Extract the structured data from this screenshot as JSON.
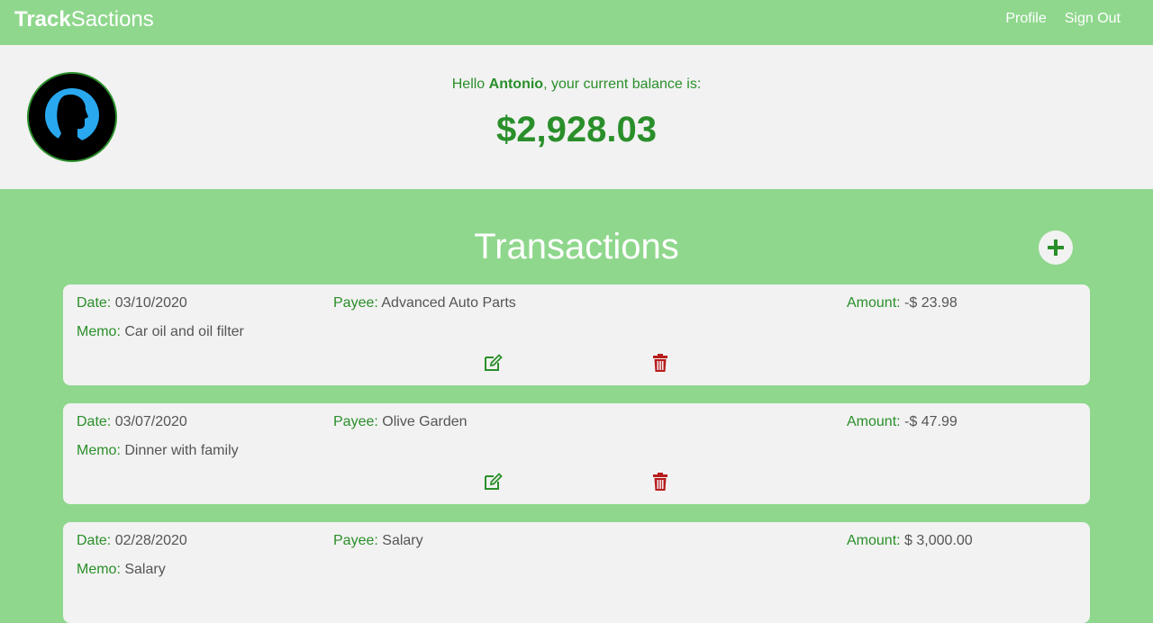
{
  "navbar": {
    "brand_bold": "Track",
    "brand_rest": "Sactions",
    "links": [
      {
        "label": "Profile"
      },
      {
        "label": "Sign Out"
      }
    ]
  },
  "header": {
    "greeting_prefix": "Hello ",
    "user_name": "Antonio",
    "greeting_suffix": ", your current balance is:",
    "balance": "$2,928.03"
  },
  "transactions": {
    "title": "Transactions",
    "labels": {
      "date": "Date:",
      "payee": "Payee:",
      "amount": "Amount:",
      "memo": "Memo:"
    },
    "items": [
      {
        "date": "03/10/2020",
        "payee": "Advanced Auto Parts",
        "amount": "-$ 23.98",
        "memo": "Car oil and oil filter"
      },
      {
        "date": "03/07/2020",
        "payee": "Olive Garden",
        "amount": "-$ 47.99",
        "memo": "Dinner with family"
      },
      {
        "date": "02/28/2020",
        "payee": "Salary",
        "amount": "$ 3,000.00",
        "memo": "Salary"
      }
    ]
  },
  "colors": {
    "accent_green": "#2a8f2a",
    "nav_bg": "#8fd78d",
    "delete_red": "#b71c1c"
  }
}
